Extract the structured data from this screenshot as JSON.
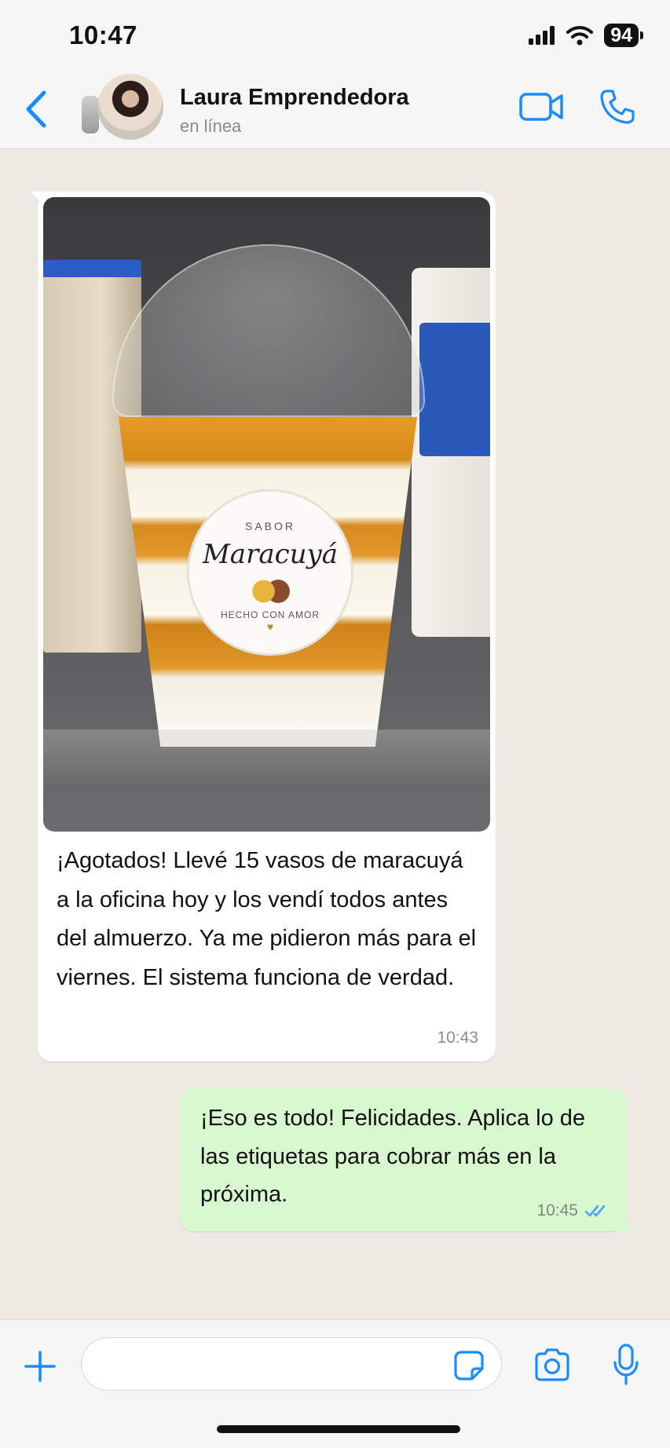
{
  "status_bar": {
    "time": "10:47",
    "battery": "94"
  },
  "header": {
    "contact_name": "Laura Emprendedora",
    "contact_status": "en línea",
    "icons": [
      "back-chevron-icon",
      "avatar",
      "video-call-icon",
      "phone-call-icon"
    ]
  },
  "messages": [
    {
      "direction": "incoming",
      "has_image": true,
      "image": {
        "label_top": "SABOR",
        "label_main": "Maracuyá",
        "label_bottom": "HECHO CON AMOR",
        "label_heart": "♥"
      },
      "text": "¡Agotados! Llevé 15 vasos de maracuyá a la oficina hoy y los vendí todos antes del almuerzo. Ya me pidieron más para el viernes. El sistema funciona de verdad.",
      "time": "10:43"
    },
    {
      "direction": "outgoing",
      "text": "¡Eso es todo! Felicidades. Aplica lo de las etiquetas para cobrar más en la próxima.",
      "time": "10:45",
      "read": true
    }
  ],
  "input_bar": {
    "placeholder": "",
    "icons": [
      "plus-icon",
      "sticker-icon",
      "camera-icon",
      "microphone-icon"
    ]
  },
  "colors": {
    "accent": "#1a8cff",
    "chat_background": "#efe9e3",
    "incoming_bubble": "#ffffff",
    "outgoing_bubble": "#d8f8cf",
    "read_ticks": "#4fa3f7"
  }
}
